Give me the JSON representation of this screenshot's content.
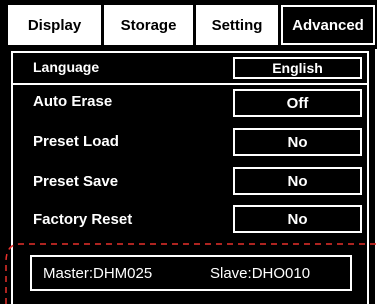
{
  "tabs": [
    {
      "label": "Display",
      "active": false
    },
    {
      "label": "Storage",
      "active": false
    },
    {
      "label": "Setting",
      "active": false
    },
    {
      "label": "Advanced",
      "active": true
    }
  ],
  "settings": [
    {
      "label": "Language",
      "value": "English"
    },
    {
      "label": "Auto Erase",
      "value": "Off"
    },
    {
      "label": "Preset Load",
      "value": "No"
    },
    {
      "label": "Preset Save",
      "value": "No"
    },
    {
      "label": "Factory Reset",
      "value": "No"
    }
  ],
  "status": {
    "master": "Master:DHM025",
    "slave": "Slave:DHO010"
  },
  "colors": {
    "background": "#000000",
    "foreground": "#ffffff",
    "highlight_dash": "#e8302b"
  }
}
